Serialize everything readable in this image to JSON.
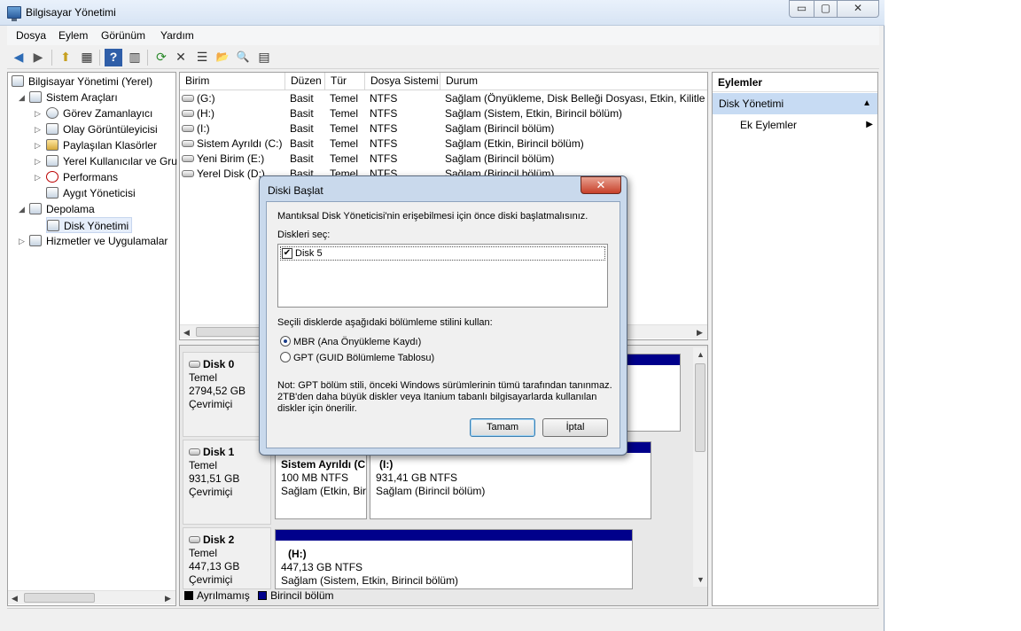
{
  "window": {
    "title": "Bilgisayar Yönetimi",
    "min": "▭",
    "max": "▢",
    "close": "✕"
  },
  "menu": [
    "Dosya",
    "Eylem",
    "Görünüm",
    "Yardım"
  ],
  "toolbar": {
    "back": "◀",
    "forward": "▶",
    "up": "⬆",
    "show_tree": "▦",
    "help": "?",
    "view": "▥",
    "refresh": "⟳",
    "delete": "✕",
    "properties": "☰",
    "open": "📂",
    "search": "🔍",
    "export": "▤"
  },
  "tree": {
    "root": "Bilgisayar Yönetimi (Yerel)",
    "system_tools": "Sistem Araçları",
    "task_scheduler": "Görev Zamanlayıcı",
    "event_viewer": "Olay Görüntüleyicisi",
    "shared_folders": "Paylaşılan Klasörler",
    "local_users": "Yerel Kullanıcılar ve Gru",
    "performance": "Performans",
    "device_manager": "Aygıt Yöneticisi",
    "storage": "Depolama",
    "disk_management": "Disk Yönetimi",
    "services": "Hizmetler ve Uygulamalar"
  },
  "volume_list": {
    "columns": [
      "Birim",
      "Düzen",
      "Tür",
      "Dosya Sistemi",
      "Durum"
    ],
    "rows": [
      [
        "(G:)",
        "Basit",
        "Temel",
        "NTFS",
        "Sağlam (Önyükleme, Disk Belleği Dosyası, Etkin, Kilitlenm"
      ],
      [
        "(H:)",
        "Basit",
        "Temel",
        "NTFS",
        "Sağlam (Sistem, Etkin, Birincil bölüm)"
      ],
      [
        "(I:)",
        "Basit",
        "Temel",
        "NTFS",
        "Sağlam (Birincil bölüm)"
      ],
      [
        "Sistem Ayrıldı (C:)",
        "Basit",
        "Temel",
        "NTFS",
        "Sağlam (Etkin, Birincil bölüm)"
      ],
      [
        "Yeni Birim (E:)",
        "Basit",
        "Temel",
        "NTFS",
        "Sağlam (Birincil bölüm)"
      ],
      [
        "Yerel Disk (D:)",
        "Basit",
        "Temel",
        "NTFS",
        "Sağlam (Birincil bölüm)"
      ]
    ]
  },
  "disks": [
    {
      "name": "Disk 0",
      "type": "Temel",
      "size": "2794,52 GB",
      "status": "Çevrimiçi"
    },
    {
      "name": "Disk 1",
      "type": "Temel",
      "size": "931,51 GB",
      "status": "Çevrimiçi",
      "p1_name": "Sistem Ayrıldı  (C",
      "p1_size": "100 MB NTFS",
      "p1_status": "Sağlam (Etkin, Bir",
      "p2_name": "(I:)",
      "p2_size": "931,41 GB NTFS",
      "p2_status": "Sağlam (Birincil bölüm)"
    },
    {
      "name": "Disk 2",
      "type": "Temel",
      "size": "447,13 GB",
      "status": "Çevrimiçi",
      "p1_name": "(H:)",
      "p1_size": "447,13 GB NTFS",
      "p1_status": "Sağlam (Sistem, Etkin, Birincil bölüm)"
    }
  ],
  "legend": {
    "unallocated": "Ayrılmamış",
    "primary": "Birincil bölüm"
  },
  "colors": {
    "primary_partition": "#00008b",
    "unallocated": "#000000",
    "selection": "#c7dbf3"
  },
  "actions": {
    "header": "Eylemler",
    "section": "Disk Yönetimi",
    "more": "Ek Eylemler"
  },
  "dialog": {
    "title": "Diski Başlat",
    "close": "✕",
    "intro": "Mantıksal Disk Yöneticisi'nin erişebilmesi için önce diski başlatmalısınız.",
    "select_label": "Diskleri seç:",
    "disk_item": "Disk 5",
    "style_label": "Seçili disklerde aşağıdaki bölümleme stilini kullan:",
    "mbr": "MBR (Ana Önyükleme Kaydı)",
    "gpt": "GPT (GUID Bölümleme Tablosu)",
    "note1": "Not: GPT bölüm stili, önceki Windows sürümlerinin tümü tarafından tanınmaz.",
    "note2": "2TB'den daha büyük diskler veya Itanium tabanlı bilgisayarlarda kullanılan",
    "note3": "diskler için önerilir.",
    "ok": "Tamam",
    "cancel": "İptal"
  }
}
